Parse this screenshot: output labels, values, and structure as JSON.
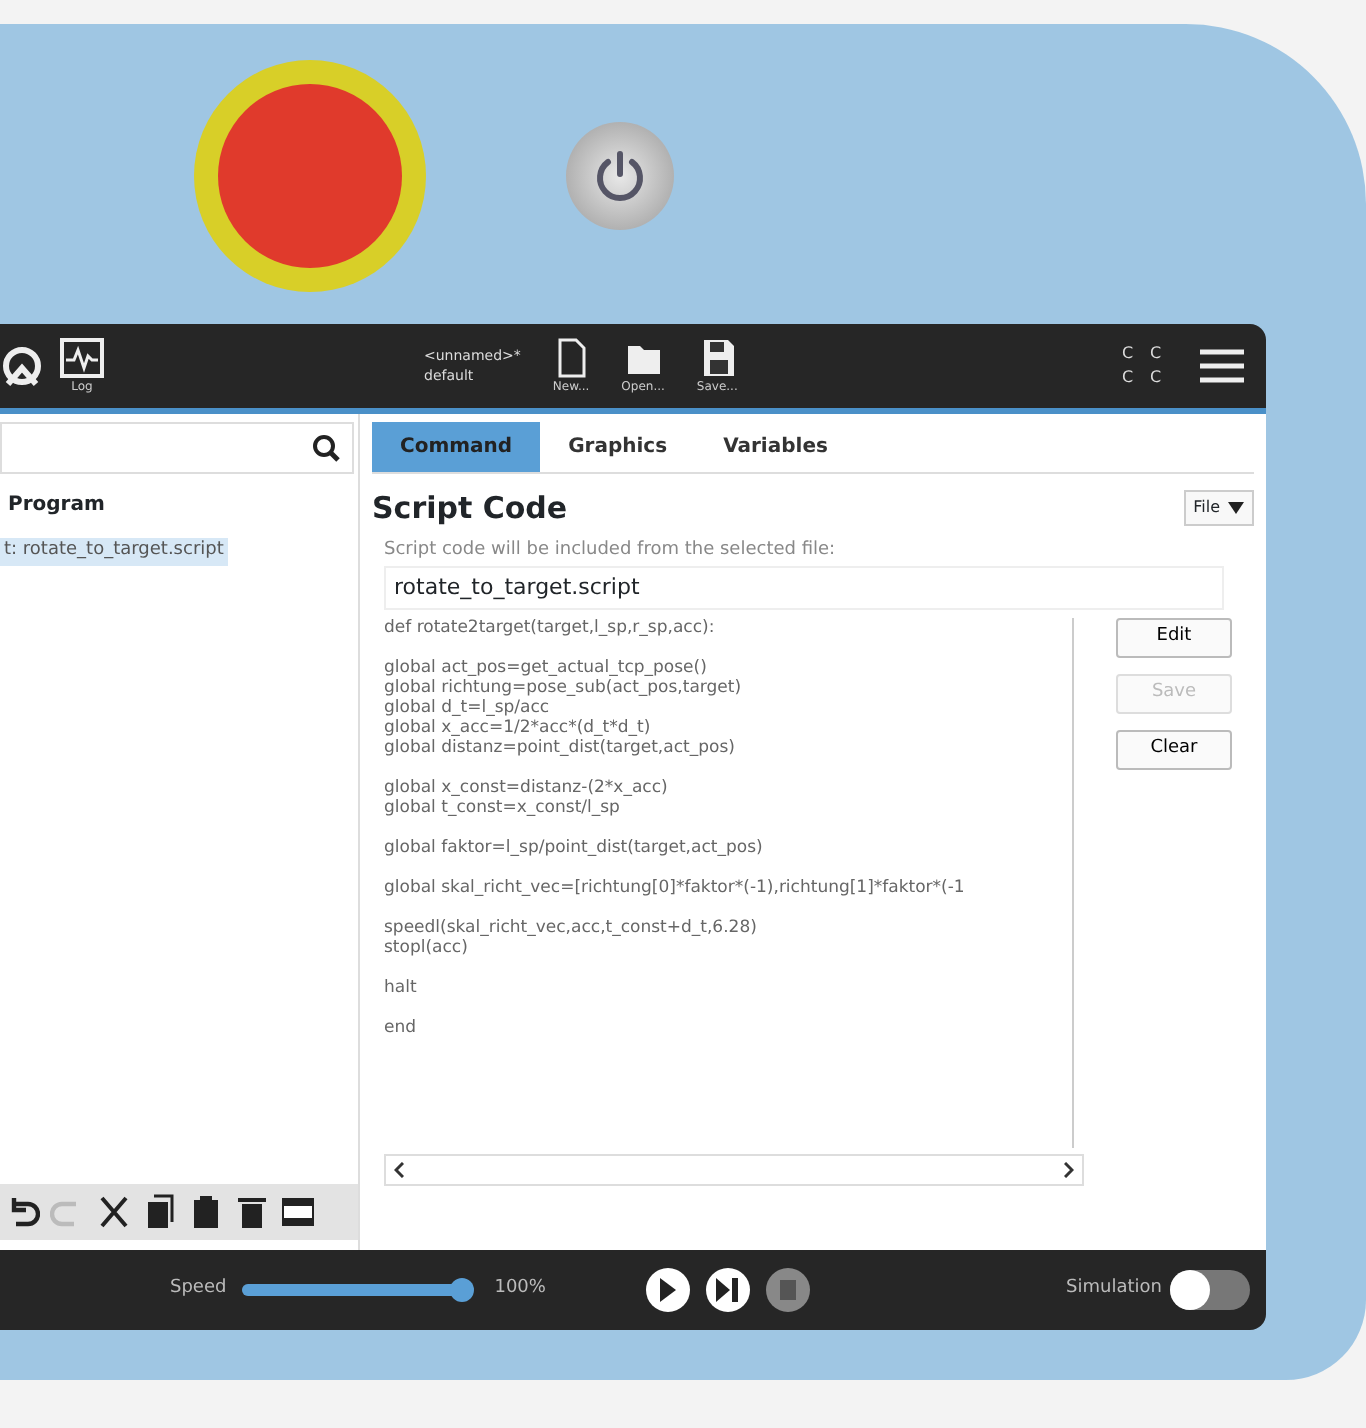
{
  "header": {
    "log_label": "Log",
    "program_name": "<unnamed>*",
    "installation_name": "default",
    "file_buttons": [
      {
        "label": "New...",
        "kind": "new"
      },
      {
        "label": "Open...",
        "kind": "open"
      },
      {
        "label": "Save...",
        "kind": "save"
      }
    ],
    "status_letters": [
      "C",
      "C",
      "C",
      "C"
    ]
  },
  "sidebar": {
    "tree": {
      "label": "Program",
      "children": [
        {
          "label": "t: rotate_to_target.script",
          "selected": true
        }
      ]
    },
    "toolbar": [
      {
        "kind": "undo",
        "disabled": false
      },
      {
        "kind": "redo",
        "disabled": true
      },
      {
        "kind": "cut",
        "disabled": false
      },
      {
        "kind": "copy",
        "disabled": false
      },
      {
        "kind": "paste",
        "disabled": false
      },
      {
        "kind": "delete",
        "disabled": false
      },
      {
        "kind": "suppress",
        "disabled": false
      }
    ]
  },
  "tabs": [
    {
      "label": "Command",
      "selected": true
    },
    {
      "label": "Graphics",
      "selected": false
    },
    {
      "label": "Variables",
      "selected": false
    }
  ],
  "script": {
    "title": "Script Code",
    "mode": "File",
    "hint": "Script code will be included from the selected file:",
    "file": "rotate_to_target.script",
    "code_blocks": [
      [
        "def rotate2target(target,l_sp,r_sp,acc):"
      ],
      [
        "global act_pos=get_actual_tcp_pose()",
        "global richtung=pose_sub(act_pos,target)",
        "global d_t=l_sp/acc",
        "global x_acc=1/2*acc*(d_t*d_t)",
        "global distanz=point_dist(target,act_pos)"
      ],
      [
        "global x_const=distanz-(2*x_acc)",
        "global t_const=x_const/l_sp"
      ],
      [
        "global faktor=l_sp/point_dist(target,act_pos)"
      ],
      [
        "global skal_richt_vec=[richtung[0]*faktor*(-1),richtung[1]*faktor*(-1"
      ],
      [
        "speedl(skal_richt_vec,acc,t_const+d_t,6.28)",
        "stopl(acc)"
      ],
      [
        "halt"
      ],
      [
        "end"
      ]
    ],
    "buttons": [
      {
        "label": "Edit",
        "disabled": false
      },
      {
        "label": "Save",
        "disabled": true
      },
      {
        "label": "Clear",
        "disabled": false
      }
    ]
  },
  "footer": {
    "speed_label": "Speed",
    "speed": {
      "level": 1.0
    },
    "speed_reading": "100%",
    "controls": [
      {
        "kind": "play",
        "disabled": false
      },
      {
        "kind": "step",
        "disabled": false
      },
      {
        "kind": "stop",
        "disabled": true
      }
    ],
    "simulation_label": "Simulation",
    "simulation": {
      "on": false
    }
  }
}
